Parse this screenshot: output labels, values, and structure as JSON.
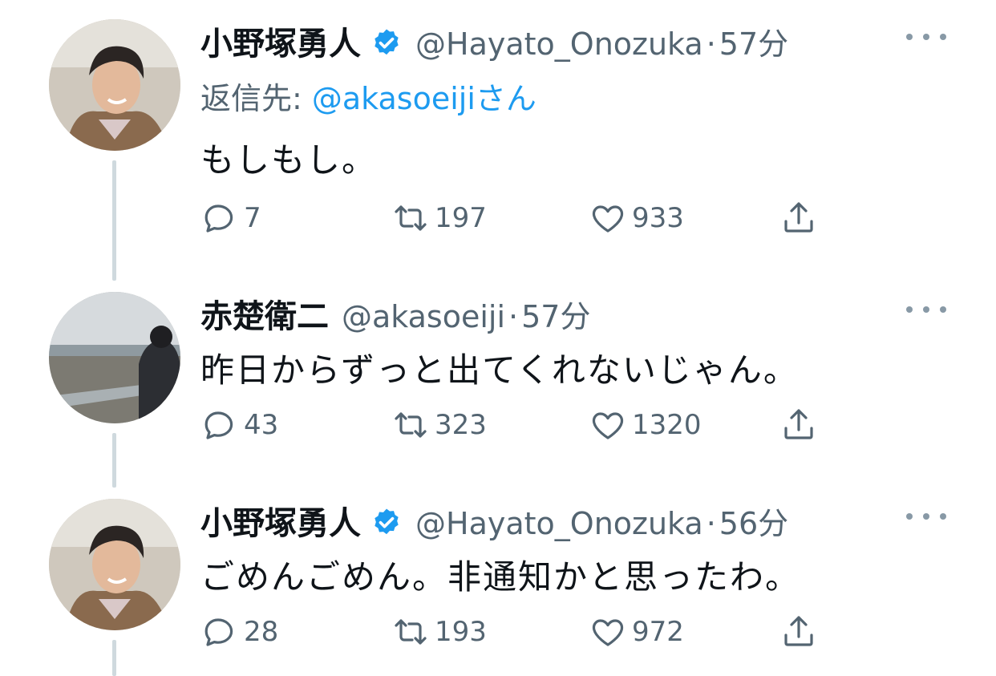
{
  "colors": {
    "text_primary": "#0f1419",
    "text_secondary": "#536471",
    "accent": "#1d9bf0",
    "thread_line": "#cfd9de"
  },
  "tweets": [
    {
      "name": "小野塚勇人",
      "verified": true,
      "handle": "@Hayato_Onozuka",
      "separator": "·",
      "time": "57分",
      "reply_label": "返信先: ",
      "reply_mention": "@akasoeiji",
      "reply_suffix": "さん",
      "text": "もしもし。",
      "replies": "7",
      "retweets": "197",
      "likes": "933"
    },
    {
      "name": "赤楚衛二",
      "verified": false,
      "handle": "@akasoeiji",
      "separator": "·",
      "time": "57分",
      "text": "昨日からずっと出てくれないじゃん。",
      "replies": "43",
      "retweets": "323",
      "likes": "1320"
    },
    {
      "name": "小野塚勇人",
      "verified": true,
      "handle": "@Hayato_Onozuka",
      "separator": "·",
      "time": "56分",
      "text": "ごめんごめん。非通知かと思ったわ。",
      "replies": "28",
      "retweets": "193",
      "likes": "972"
    }
  ],
  "icons": {
    "reply": "reply-icon",
    "retweet": "retweet-icon",
    "like": "heart-icon",
    "share": "share-icon",
    "more": "more-icon",
    "verified": "verified-badge-icon"
  }
}
